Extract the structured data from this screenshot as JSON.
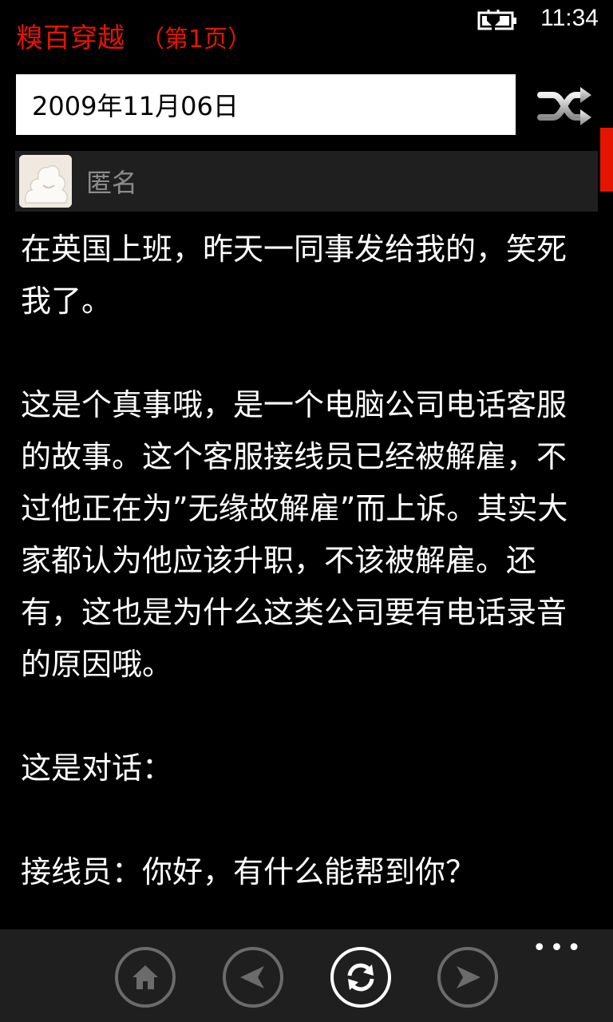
{
  "status": {
    "time": "11:34",
    "icons": [
      "battery-charging-icon"
    ]
  },
  "header": {
    "app_name": "糗百穿越",
    "page_label": "（第1页）"
  },
  "date_picker": {
    "value": "2009年11月06日",
    "shuffle_icon": "shuffle-icon"
  },
  "post": {
    "author": "匿名",
    "avatar_icon": "anonymous-avatar-icon",
    "paragraphs": [
      "在英国上班，昨天一同事发给我的，笑死我了。",
      "这是个真事哦，是一个电脑公司电话客服的故事。这个客服接线员已经被解雇，不过他正在为”无缘故解雇”而上诉。其实大家都认为他应该升职，不该被解雇。还有，这也是为什么这类公司要有电话录音的原因哦。",
      "这是对话：",
      "接线员：你好，有什么能帮到你？"
    ]
  },
  "app_bar": {
    "more_label": "•••",
    "buttons": [
      {
        "name": "home-button",
        "icon": "home-icon"
      },
      {
        "name": "previous-button",
        "icon": "arrow-left-icon"
      },
      {
        "name": "refresh-button",
        "icon": "refresh-icon"
      },
      {
        "name": "next-button",
        "icon": "arrow-right-icon"
      }
    ]
  },
  "colors": {
    "accent": "#e51400",
    "background": "#000000",
    "app_bar": "#1f1f1f",
    "author_row": "#1f1f1f"
  }
}
